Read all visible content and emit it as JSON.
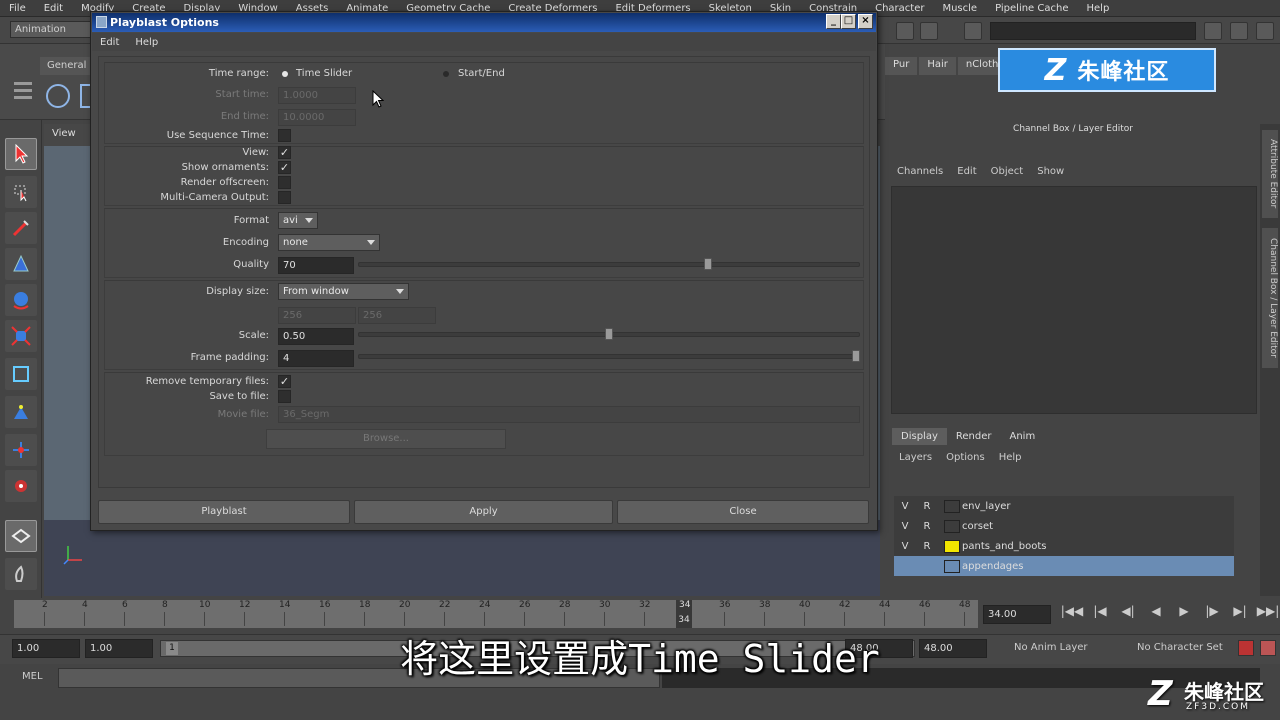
{
  "menubar": [
    "File",
    "Edit",
    "Modify",
    "Create",
    "Display",
    "Window",
    "Assets",
    "Animate",
    "Geometry Cache",
    "Create Deformers",
    "Edit Deformers",
    "Skeleton",
    "Skin",
    "Constrain",
    "Character",
    "Muscle",
    "Pipeline Cache",
    "Help"
  ],
  "statusline": {
    "mode": "Animation"
  },
  "shelf": {
    "tab_general": "General"
  },
  "viewport": {
    "menu_view": "View"
  },
  "right_panel": {
    "tabs": [
      "Pur",
      "Hair",
      "nCloth"
    ],
    "logo_text": "朱峰社区",
    "channel_box_title": "Channel Box / Layer Editor",
    "channel_menu": [
      "Channels",
      "Edit",
      "Object",
      "Show"
    ],
    "layer_tabs": [
      "Display",
      "Render",
      "Anim"
    ],
    "layer_menu": [
      "Layers",
      "Options",
      "Help"
    ],
    "layers": [
      {
        "v": "V",
        "r": "R",
        "name": "env_layer",
        "color": ""
      },
      {
        "v": "V",
        "r": "R",
        "name": "corset",
        "color": ""
      },
      {
        "v": "V",
        "r": "R",
        "name": "pants_and_boots",
        "color": "#f2e600"
      },
      {
        "v": "",
        "r": "",
        "name": "appendages",
        "color": ""
      }
    ],
    "side_tabs": [
      "Attribute Editor",
      "Channel Box / Layer Editor"
    ]
  },
  "dialog": {
    "title": "Playblast Options",
    "menu": [
      "Edit",
      "Help"
    ],
    "time_range_label": "Time range:",
    "time_range_option1": "Time Slider",
    "time_range_option2": "Start/End",
    "time_range_selected": "Time Slider",
    "start_time_label": "Start time:",
    "start_time_value": "1.0000",
    "end_time_label": "End time:",
    "end_time_value": "10.0000",
    "use_sequence_time_label": "Use Sequence Time:",
    "use_sequence_time": false,
    "view_label": "View:",
    "view": true,
    "show_ornaments_label": "Show ornaments:",
    "show_ornaments": true,
    "render_offscreen_label": "Render offscreen:",
    "render_offscreen": false,
    "multi_camera_label": "Multi-Camera Output:",
    "multi_camera": false,
    "format_label": "Format",
    "format_value": "avi",
    "encoding_label": "Encoding",
    "encoding_value": "none",
    "quality_label": "Quality",
    "quality_value": "70",
    "quality_fraction": 0.7,
    "display_size_label": "Display size:",
    "display_size_value": "From window",
    "display_width": "256",
    "display_height": "256",
    "scale_label": "Scale:",
    "scale_value": "0.50",
    "scale_fraction": 0.5,
    "frame_padding_label": "Frame padding:",
    "frame_padding_value": "4",
    "frame_padding_fraction": 1.0,
    "remove_temp_label": "Remove temporary files:",
    "remove_temp": true,
    "save_to_file_label": "Save to file:",
    "save_to_file": false,
    "movie_file_label": "Movie file:",
    "movie_file_value": "36_Segm",
    "browse_label": "Browse...",
    "btn_playblast": "Playblast",
    "btn_apply": "Apply",
    "btn_close": "Close"
  },
  "timeline": {
    "ticks": [
      "2",
      "4",
      "6",
      "8",
      "10",
      "12",
      "14",
      "16",
      "18",
      "20",
      "22",
      "24",
      "26",
      "28",
      "30",
      "32",
      "34",
      "36",
      "38",
      "40",
      "42",
      "44",
      "46",
      "48"
    ],
    "current_frame": "34",
    "current_frame_field": "34.00"
  },
  "range": {
    "start": "1.00",
    "playback_start": "1.00",
    "handle_label": "1",
    "playback_end": "48.00",
    "end": "48.00",
    "anim_layer": "No Anim Layer",
    "character_set": "No Character Set"
  },
  "command": {
    "mel_label": "MEL"
  },
  "subtitle": "将这里设置成Time Slider",
  "watermark": {
    "title": "朱峰社区",
    "url": "ZF3D.COM"
  }
}
